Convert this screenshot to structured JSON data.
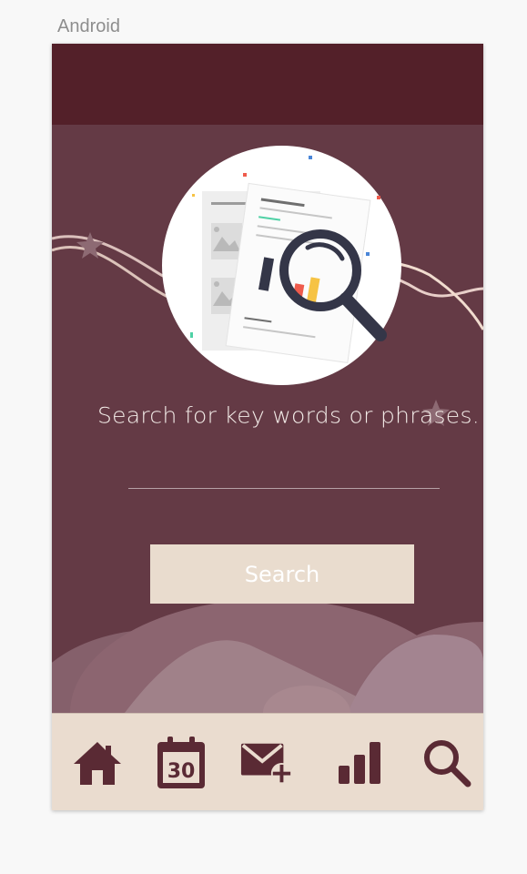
{
  "frame_label": "Android",
  "prompt_text": "Search for key words or phrases.",
  "search": {
    "value": "",
    "placeholder": "",
    "button_label": "Search"
  },
  "calendar_day": "30",
  "nav_items": [
    "home-icon",
    "calendar-icon",
    "compose-mail-icon",
    "stats-icon",
    "search-icon"
  ],
  "colors": {
    "status_bar": "#532029",
    "background": "#643a45",
    "nav_bar": "#eadccf",
    "nav_icon": "#5a2a34",
    "button": "#e9dcce",
    "magnifier": "#343648"
  }
}
